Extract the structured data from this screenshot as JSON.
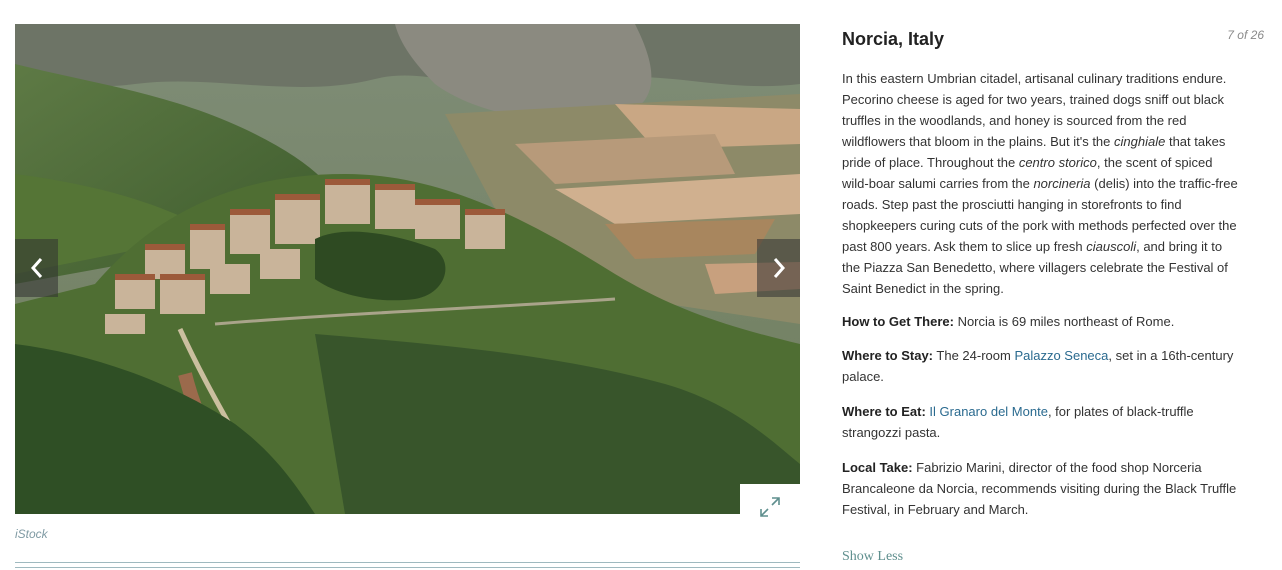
{
  "slide": {
    "title": "Norcia, Italy",
    "counter": "7 of 26",
    "credit": "iStock"
  },
  "icons": {
    "prev": "chevron-left-icon",
    "next": "chevron-right-icon",
    "expand": "expand-icon"
  },
  "description": {
    "segments": [
      "In this eastern Umbrian citadel, artisanal culinary traditions endure. Pecorino cheese is aged for two years, trained dogs sniff out black truffles in the woodlands, and honey is sourced from the red wildflowers that bloom in the plains. But it's the ",
      "cinghiale",
      " that takes pride of place. Throughout the ",
      "centro storico",
      ", the scent of spiced wild-boar salumi carries from the ",
      "norcineria",
      " (delis) into the traffic-free roads. Step past the prosciutti hanging in storefronts to find shopkeepers curing cuts of the pork with methods perfected over the past 800 years. Ask them to slice up fresh ",
      "ciauscoli",
      ", and bring it to the Piazza San Benedetto, where villagers celebrate the Festival of Saint Benedict in the spring."
    ]
  },
  "get_there": {
    "label": "How to Get There:",
    "text": " Norcia is 69 miles northeast of Rome."
  },
  "stay": {
    "label": "Where to Stay:",
    "pre": " The 24-room ",
    "link": "Palazzo Seneca",
    "post": ", set in a 16th-century palace."
  },
  "eat": {
    "label": "Where to Eat:",
    "pre": " ",
    "link": "Il Granaro del Monte",
    "post": ", for plates of black-truffle strangozzi pasta."
  },
  "local_take": {
    "label": "Local Take:",
    "text": " Fabrizio Marini, director of the food shop Norceria Brancaleone da Norcia, recommends visiting during the Black Truffle Festival, in February and March."
  },
  "show_less": "Show Less",
  "colors": {
    "link": "#2a6a8f",
    "show_less": "#5f8f8e",
    "rule": "#9fb9bf"
  }
}
